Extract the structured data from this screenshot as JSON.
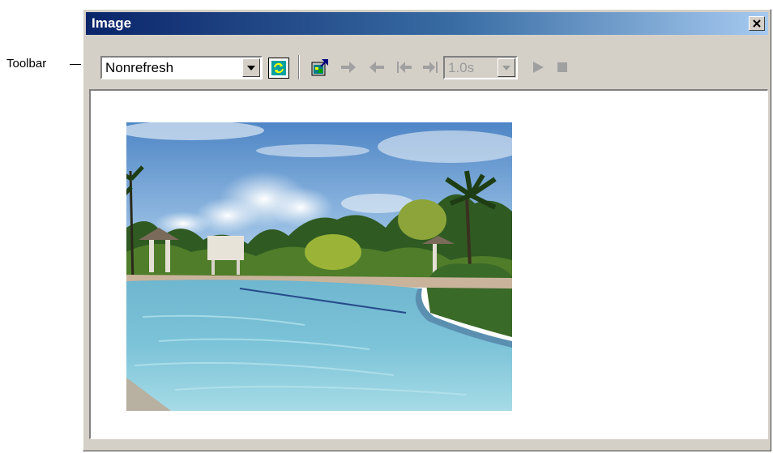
{
  "callout": {
    "label": "Toolbar"
  },
  "window": {
    "title": "Image",
    "close_icon": "close-x-icon"
  },
  "toolbar": {
    "refresh_mode": {
      "selected": "Nonrefresh"
    },
    "interval": {
      "selected": "1.0s",
      "enabled": false
    },
    "buttons": [
      {
        "name": "refresh-icon",
        "enabled": true
      },
      {
        "name": "properties-icon",
        "enabled": true
      },
      {
        "name": "step-forward-icon",
        "enabled": false
      },
      {
        "name": "step-back-icon",
        "enabled": false
      },
      {
        "name": "first-frame-icon",
        "enabled": false
      },
      {
        "name": "last-frame-icon",
        "enabled": false
      },
      {
        "name": "play-icon",
        "enabled": false
      },
      {
        "name": "stop-icon",
        "enabled": false
      }
    ]
  },
  "colors": {
    "title_gradient_start": "#0a246a",
    "title_gradient_end": "#a6caf0",
    "chrome": "#d4d0c8",
    "disabled_icon": "#9a9a9a"
  }
}
